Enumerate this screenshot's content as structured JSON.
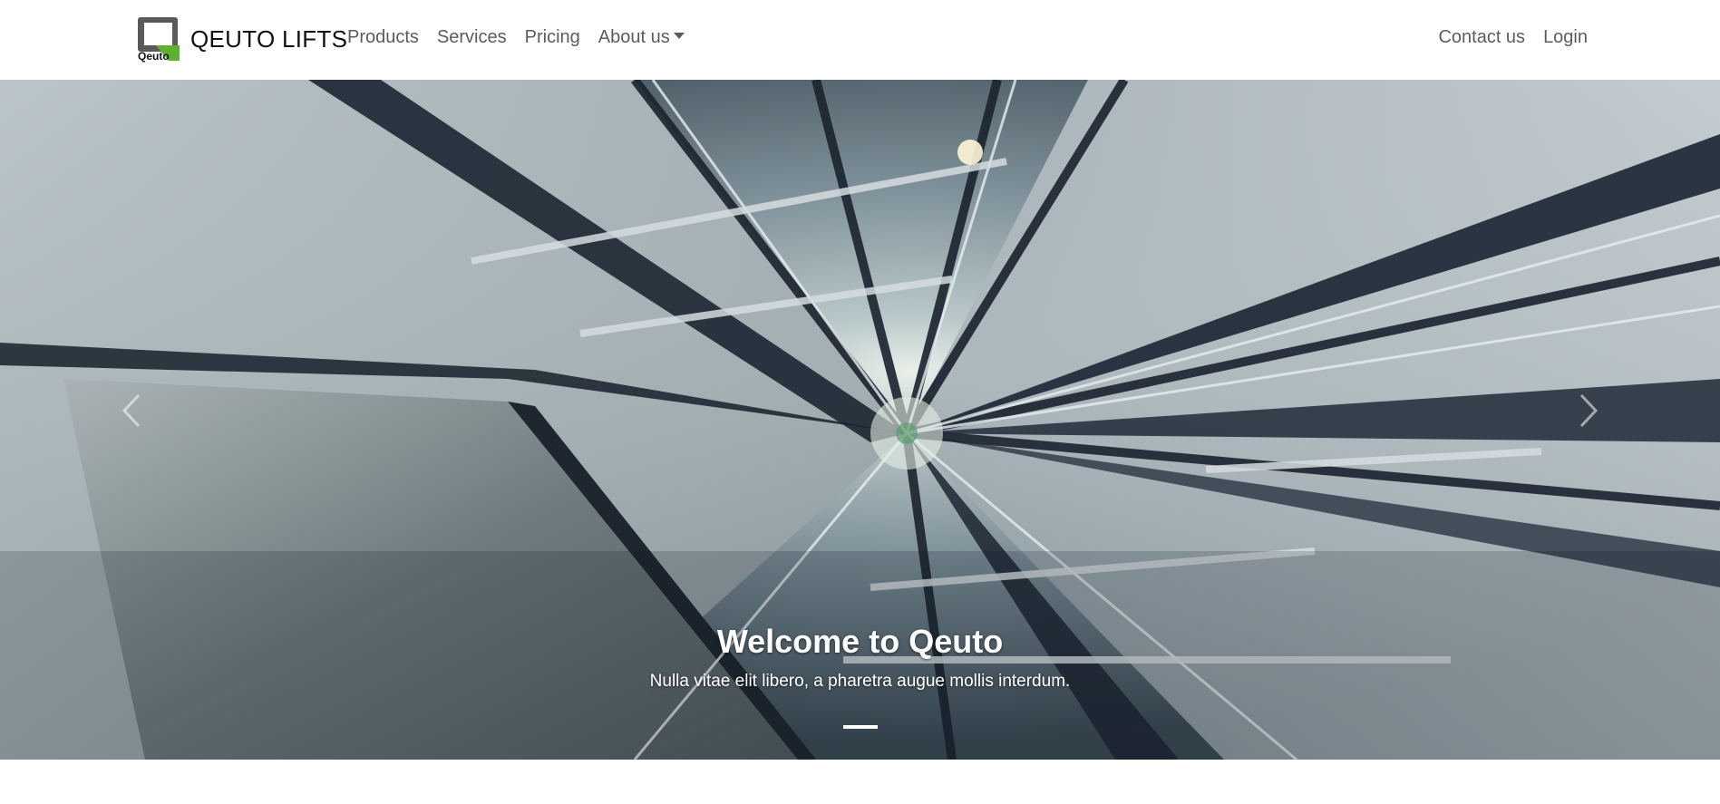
{
  "navbar": {
    "brand_name": "QEUTO LIFTS",
    "logo_text": "Qeuto",
    "links_left": [
      {
        "label": "Products"
      },
      {
        "label": "Services"
      },
      {
        "label": "Pricing"
      },
      {
        "label": "About us",
        "dropdown": true
      }
    ],
    "links_right": [
      {
        "label": "Contact us"
      },
      {
        "label": "Login"
      }
    ]
  },
  "carousel": {
    "slide_title": "Welcome to Qeuto",
    "slide_text": "Nulla vitae elit libero, a pharetra augue mollis interdum.",
    "indicator_count": 1,
    "active_indicator": 1,
    "prev_icon": "chevron-left-icon",
    "next_icon": "chevron-right-icon"
  },
  "colors": {
    "logo_dark": "#5a5a5a",
    "logo_green": "#5cb130",
    "nav_text": "#5c5c5c",
    "brand_text": "#111111"
  }
}
